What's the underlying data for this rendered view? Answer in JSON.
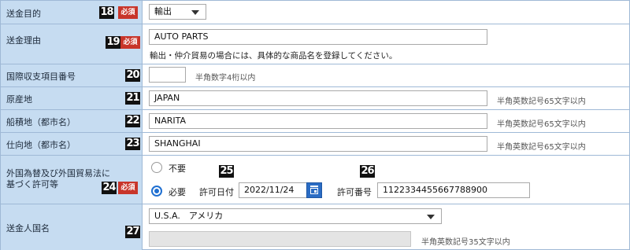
{
  "required_badge": "必須",
  "rows": {
    "purpose": {
      "number": "18",
      "label": "送金目的",
      "value": "輸出"
    },
    "reason": {
      "number": "19",
      "label": "送金理由",
      "value": "AUTO PARTS",
      "note": "輸出・仲介貿易の場合には、具体的な商品名を登録してください。"
    },
    "bop_code": {
      "number": "20",
      "label": "国際収支項目番号",
      "value": "",
      "hint": "半角数字4桁以内"
    },
    "origin": {
      "number": "21",
      "label": "原産地",
      "value": "JAPAN",
      "hint": "半角英数記号65文字以内"
    },
    "loading": {
      "number": "22",
      "label": "船積地（都市名）",
      "value": "NARITA",
      "hint": "半角英数記号65文字以内"
    },
    "destination": {
      "number": "23",
      "label": "仕向地（都市名）",
      "value": "SHANGHAI",
      "hint": "半角英数記号65文字以内"
    },
    "permit": {
      "number": "24",
      "label_line1": "外国為替及び外国貿易法に",
      "label_line2": "基づく許可等",
      "option_none": "不要",
      "option_required": "必要",
      "selected": "必要",
      "date_number": "25",
      "date_label": "許可日付",
      "date_value": "2022/11/24",
      "permit_no_number": "26",
      "permit_no_label": "許可番号",
      "permit_no_value": "1122334455667788900"
    },
    "remitter_country": {
      "number": "27",
      "label": "送金人国名",
      "country_value": "U.S.A.　アメリカ",
      "name_value": "",
      "hint": "半角英数記号35文字以内"
    }
  },
  "icons": {
    "dropdown": "chevron-down-icon",
    "calendar": "calendar-icon"
  }
}
